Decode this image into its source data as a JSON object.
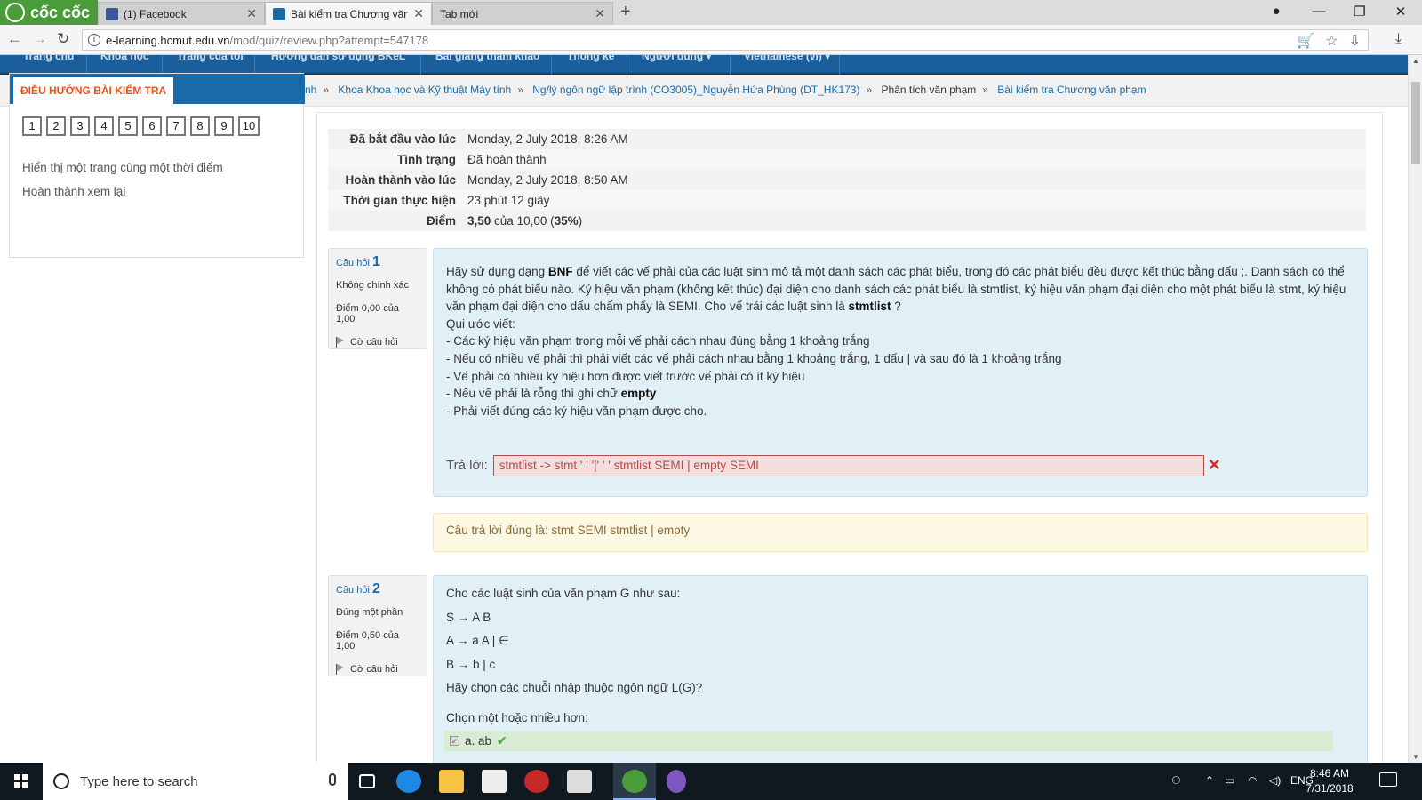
{
  "browser": {
    "brand": "cốc cốc",
    "tabs": [
      {
        "label": "(1) Facebook",
        "active": false
      },
      {
        "label": "Bài kiểm tra Chương văn p",
        "active": true
      },
      {
        "label": "Tab mới",
        "active": false
      }
    ],
    "url_host": "e-learning.hcmut.edu.vn",
    "url_path": "/mod/quiz/review.php?attempt=547178",
    "colors": {
      "brand": "#4a9b3a",
      "nav": "#1a5f9c"
    }
  },
  "topnav": {
    "items": [
      "Trang chủ",
      "Khóa học",
      "Trang của tôi",
      "Hướng dẫn sử dụng BKeL",
      "Bài giảng tham khảo",
      "Thống kê",
      "Người dùng ▾",
      "Vietnamese (vi) ▾"
    ]
  },
  "breadcrumb": [
    {
      "label": "nh",
      "link": true
    },
    {
      "label": "Khoa Khoa học và Kỹ thuật Máy tính",
      "link": true
    },
    {
      "label": "Ng/lý ngôn ngữ lập trình (CO3005)_Nguyễn Hứa Phùng (DT_HK173)",
      "link": true
    },
    {
      "label": "Phân tích văn phạm",
      "link": false
    },
    {
      "label": "Bài kiểm tra Chương văn phạm",
      "link": true
    }
  ],
  "quiz_nav": {
    "title": "ĐIỀU HƯỚNG BÀI KIỂM TRA",
    "numbers": [
      "1",
      "2",
      "3",
      "4",
      "5",
      "6",
      "7",
      "8",
      "9",
      "10"
    ],
    "show_one_page": "Hiển thị một trang cùng một thời điểm",
    "finish_review": "Hoàn thành xem lại"
  },
  "summary": [
    {
      "label": "Đã bắt đầu vào lúc",
      "value": "Monday, 2 July 2018, 8:26 AM"
    },
    {
      "label": "Tình trạng",
      "value": "Đã hoàn thành"
    },
    {
      "label": "Hoàn thành vào lúc",
      "value": "Monday, 2 July 2018, 8:50 AM"
    },
    {
      "label": "Thời gian thực hiện",
      "value": "23 phút 12 giây"
    },
    {
      "label": "Điểm",
      "score": "3,50",
      "of": "của 10,00 (",
      "percent": "35%",
      "close": ")"
    }
  ],
  "q1": {
    "prefix": "Câu hỏi",
    "number": "1",
    "state": "Không chính xác",
    "grade": "Điểm 0,00 của 1,00",
    "flag": "Cờ câu hỏi",
    "text_a": "Hãy sử dụng dạng ",
    "text_bnf": "BNF",
    "text_b": " để viết các vế phải của các luật sinh mô tả một danh sách các phát biểu, trong đó các phát biểu đều được kết thúc bằng dấu ;. Danh sách có thể không có phát biểu nào. Ký hiệu văn phạm (không kết thúc) đại diện cho danh sách các phát biểu là stmtlist, ký hiệu văn phạm đại diện cho một phát biểu là stmt, ký hiệu văn phạm đại diện cho dấu chấm phẩy là SEMI. Cho vế trái các luật sinh là ",
    "text_stmtlist": "stmtlist",
    "text_c": " ?",
    "rules_title": "Qui ước viết:",
    "rule1": "- Các ký hiệu văn phạm trong mỗi vế phải cách nhau đúng bằng 1 khoảng trắng",
    "rule2": "- Nếu có nhiều vế phải thì phải viết các vế phải cách nhau bằng 1 khoảng trắng, 1 dấu | và sau đó là 1 khoảng trắng",
    "rule3": "- Vế phải có nhiều ký hiệu hơn được viết trước vế phải có ít ký hiệu",
    "rule4a": "- Nếu vế phải là rỗng thì ghi chữ ",
    "rule4b": "empty",
    "rule5": "- Phải viết đúng các ký hiệu văn phạm được cho.",
    "answer_label": "Trả lời:",
    "answer_value": "stmtlist -> stmt ' ' '|' ' ' stmtlist SEMI | empty SEMI",
    "correct_answer": "Câu trả lời đúng là: stmt SEMI stmtlist | empty"
  },
  "q2": {
    "prefix": "Câu hỏi",
    "number": "2",
    "state": "Đúng một phần",
    "grade": "Điểm 0,50 của 1,00",
    "flag": "Cờ câu hỏi",
    "intro": "Cho các luật sinh của văn phạm G như sau:",
    "prod1": "S → A B",
    "prod2": "A → a A | ∈",
    "prod3": "B → b | c",
    "question": "Hãy chọn các chuỗi nhập thuộc ngôn ngữ L(G)?",
    "prompt": "Chọn một hoặc nhiều hơn:",
    "choice_a": "a. ab"
  },
  "taskbar": {
    "search_placeholder": "Type here to search",
    "lang": "ENG",
    "time": "8:46 AM",
    "date": "7/31/2018"
  }
}
